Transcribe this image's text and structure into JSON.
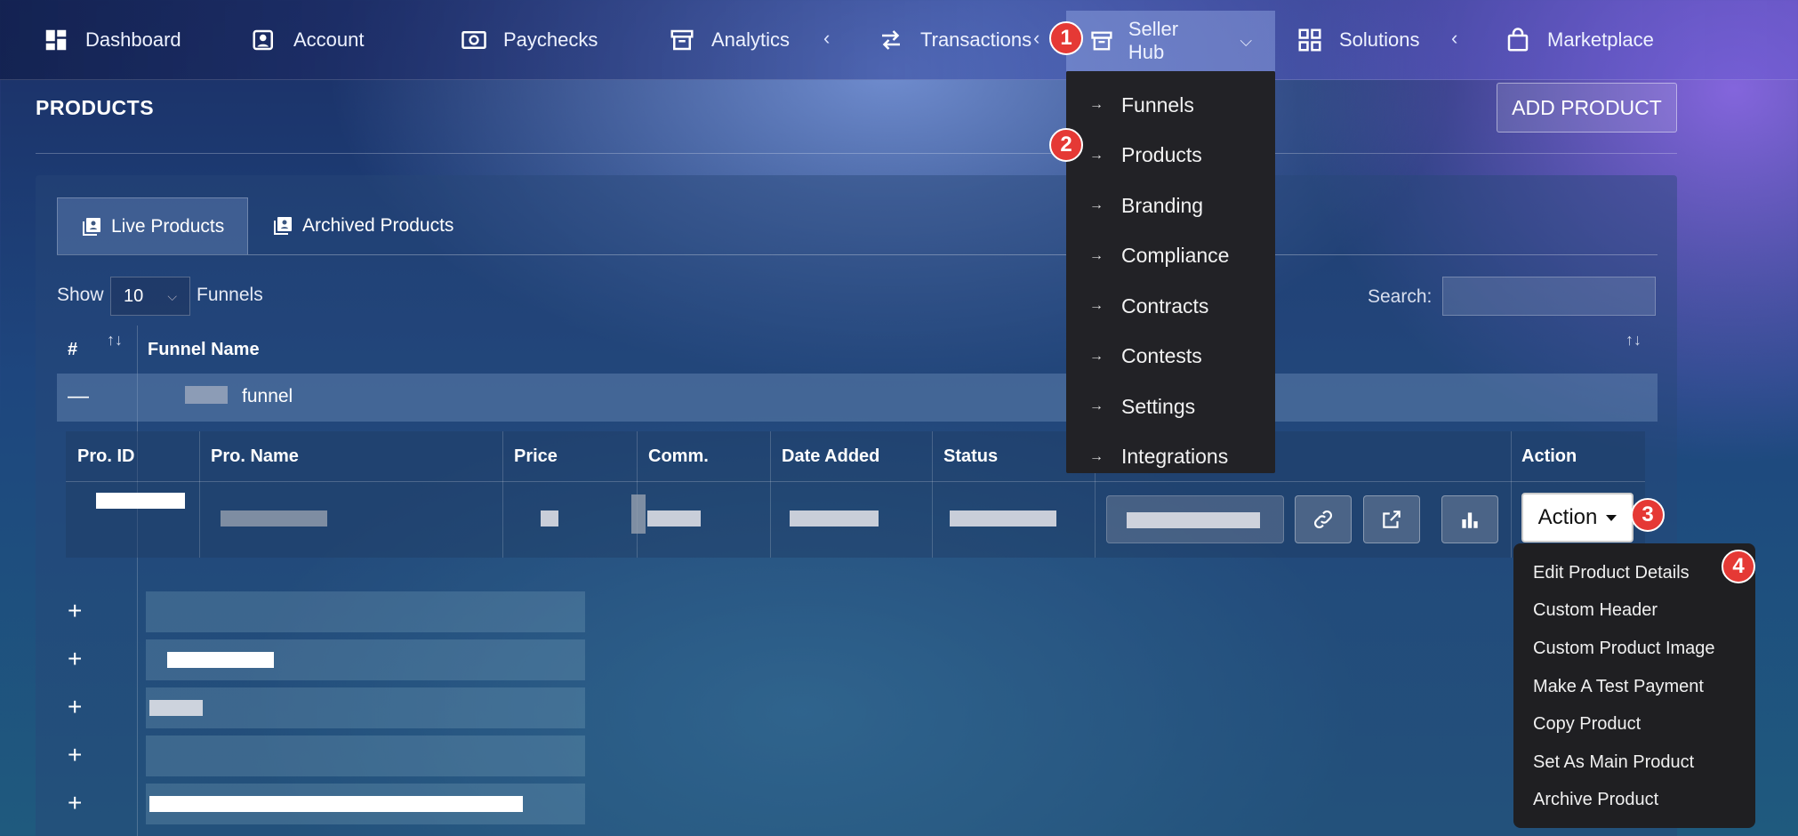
{
  "nav": {
    "items": [
      {
        "label": "Dashboard",
        "icon": "dashboard-icon"
      },
      {
        "label": "Account",
        "icon": "account-icon"
      },
      {
        "label": "Paychecks",
        "icon": "paychecks-icon"
      },
      {
        "label": "Analytics",
        "icon": "archive-icon"
      },
      {
        "label": "Transactions",
        "icon": "swap-icon"
      },
      {
        "label": "Seller Hub",
        "icon": "box-icon"
      },
      {
        "label": "Solutions",
        "icon": "grid-icon"
      },
      {
        "label": "Marketplace",
        "icon": "bag-icon"
      }
    ],
    "seller_hub_menu": [
      "Funnels",
      "Products",
      "Branding",
      "Compliance",
      "Contracts",
      "Contests",
      "Settings",
      "Integrations"
    ]
  },
  "markers": [
    "1",
    "2",
    "3",
    "4"
  ],
  "page": {
    "title": "PRODUCTS",
    "add_button": "ADD PRODUCT"
  },
  "tabs": {
    "live": "Live Products",
    "archived": "Archived Products"
  },
  "controls": {
    "show": "Show",
    "page_size": "10",
    "funnels": "Funnels",
    "search": "Search:"
  },
  "table": {
    "headers": [
      "#",
      "Funnel Name"
    ],
    "expanded_row_label": "funnel"
  },
  "subtable": {
    "headers": [
      "Pro. ID",
      "Pro. Name",
      "Price",
      "Comm.",
      "Date Added",
      "Status",
      "Action"
    ]
  },
  "action": {
    "button": "Action",
    "menu": [
      "Edit Product Details",
      "Custom Header",
      "Custom Product Image",
      "Make A Test Payment",
      "Copy Product",
      "Set As Main Product",
      "Archive Product"
    ]
  },
  "colors": {
    "marker": "#e53935",
    "dropdown_bg": "#222226"
  }
}
